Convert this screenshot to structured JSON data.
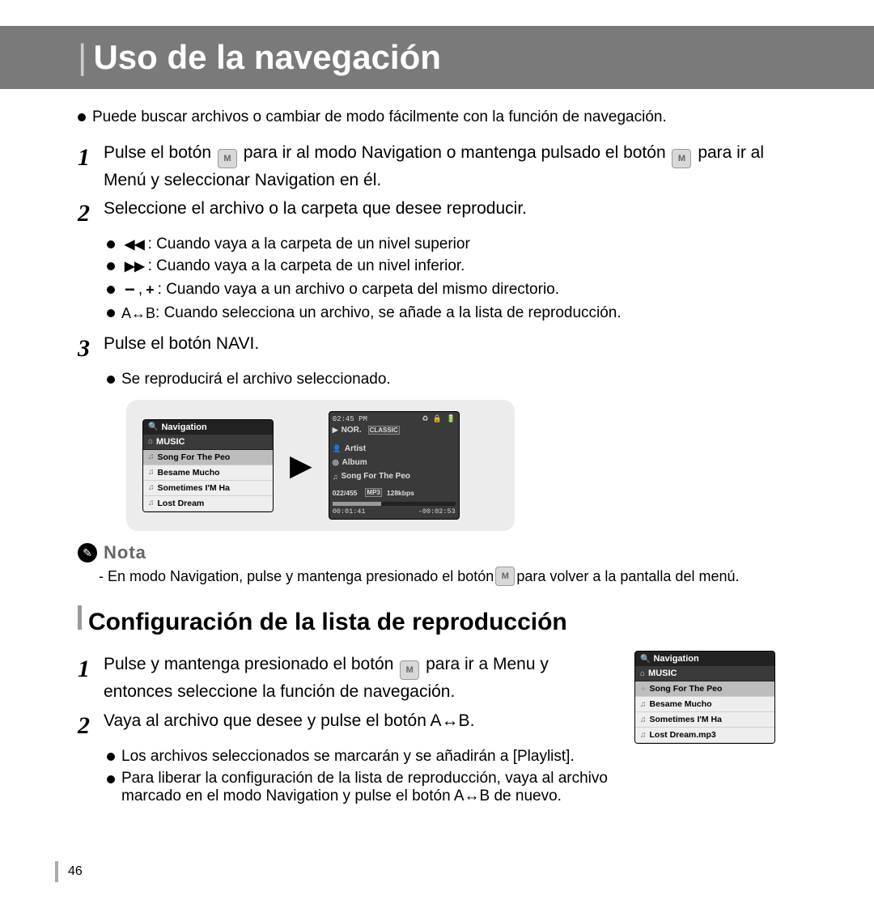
{
  "title": "Uso de la navegación",
  "intro_bullet": "Puede buscar archivos o cambiar de modo fácilmente con la función de navegación.",
  "steps": {
    "s1_a": "Pulse el botón ",
    "s1_b": " para ir al modo Navigation o mantenga pulsado el botón ",
    "s1_c": " para ir al Menú y seleccionar Navigation en él.",
    "s2": "Seleccione el archivo o la carpeta que desee reproducir.",
    "s3": "Pulse el botón NAVI."
  },
  "sub": {
    "b1": ": Cuando vaya a la carpeta de un nivel superior",
    "b2": ": Cuando vaya a la carpeta de un nivel inferior.",
    "b3": ": Cuando vaya a un archivo o carpeta del mismo directorio.",
    "b4_pre": "A↔B ",
    "b4": ": Cuando selecciona un archivo, se añade a la lista de reproducción.",
    "b5": "Se reproducirá el archivo seleccionado."
  },
  "device1": {
    "nav_label": "Navigation",
    "music_label": "MUSIC",
    "songs": [
      "Song For The Peo",
      "Besame Mucho",
      "Sometimes I'M Ha",
      "Lost Dream"
    ]
  },
  "playback": {
    "time_top": "02:45 PM",
    "play_mode": "NOR.",
    "classic": "CLASSIC",
    "artist": "Artist",
    "album": "Album",
    "song": "Song For The Peo",
    "track": "022/455",
    "format": "MP3",
    "bitrate": "128kbps",
    "elapsed": "00:01:41",
    "remain": "-00:02:53"
  },
  "nota": {
    "label": "Nota",
    "text_a": "- En modo Navigation, pulse y mantenga presionado el botón ",
    "text_b": " para volver a la pantalla del menú."
  },
  "section2": {
    "title": "Configuración de la lista de reproducción",
    "s1_a": "Pulse y mantenga presionado el botón ",
    "s1_b": " para ir a Menu y entonces seleccione la función de navegación.",
    "s2": "Vaya al archivo que desee y pulse el botón A↔B.",
    "b1": "Los archivos seleccionados se marcarán y se añadirán a [Playlist].",
    "b2": "Para liberar la configuración de la lista de reproducción, vaya al archivo marcado en el modo Navigation y pulse el botón A↔B de nuevo."
  },
  "device2": {
    "nav_label": "Navigation",
    "music_label": "MUSIC",
    "songs": [
      "Song For The Peo",
      "Besame Mucho",
      "Sometimes I'M Ha",
      "Lost Dream.mp3"
    ]
  },
  "page_num": "46",
  "m_label": "M"
}
